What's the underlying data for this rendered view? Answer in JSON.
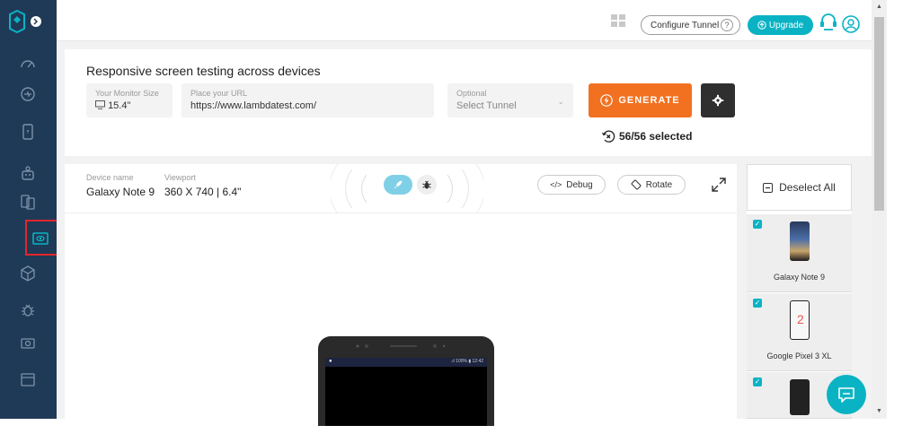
{
  "topbar": {
    "configure_tunnel": "Configure Tunnel",
    "help": "?",
    "upgrade": "Upgrade"
  },
  "main": {
    "title": "Responsive screen testing across devices",
    "monitor": {
      "label": "Your Monitor Size",
      "value": "15.4\""
    },
    "url": {
      "label": "Place your URL",
      "value": "https://www.lambdatest.com/"
    },
    "tunnel": {
      "label": "Optional",
      "value": "Select Tunnel"
    },
    "generate": "GENERATE",
    "selected": "56/56 selected"
  },
  "viewer": {
    "device_label": "Device name",
    "device_value": "Galaxy Note 9",
    "viewport_label": "Viewport",
    "viewport_value": "360 X 740 | 6.4\"",
    "debug": "Debug",
    "rotate": "Rotate",
    "phone_status": ".ıl 100% ▮ 12:42"
  },
  "devices": {
    "deselect": "Deselect All",
    "items": [
      {
        "name": "Galaxy Note 9"
      },
      {
        "name": "Google Pixel 3 XL"
      },
      {
        "name": ""
      }
    ]
  },
  "colors": {
    "sidebar": "#1f3a57",
    "accent": "#0ab3c4",
    "generate": "#f27121",
    "highlight": "#e2262b"
  }
}
